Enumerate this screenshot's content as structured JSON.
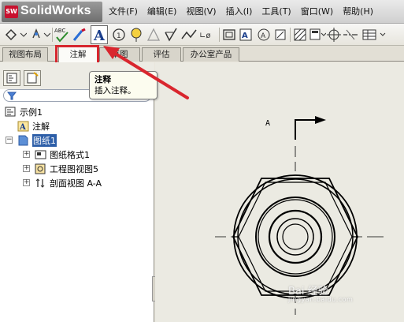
{
  "app": {
    "logo_badge": "SW",
    "name": "SolidWorks"
  },
  "menu": [
    "文件(F)",
    "编辑(E)",
    "视图(V)",
    "插入(I)",
    "工具(T)",
    "窗口(W)",
    "帮助(H)"
  ],
  "toolbar": {
    "spell_label": "ABC",
    "note_label": "A",
    "weld_label": "∟ø"
  },
  "tabs": [
    {
      "label": "视图布局",
      "active": false
    },
    {
      "label": "注解",
      "active": true
    },
    {
      "label": "草图",
      "active": false
    },
    {
      "label": "评估",
      "active": false
    },
    {
      "label": "办公室产品",
      "active": false
    }
  ],
  "tooltip": {
    "title": "注释",
    "description": "插入注释。"
  },
  "tree": {
    "root": "示例1",
    "annotations": "注解",
    "sheet": "图纸1",
    "children": [
      "图纸格式1",
      "工程图视图5",
      "剖面视图 A-A"
    ]
  },
  "drawing": {
    "section_label": "A"
  },
  "watermark": {
    "text": "Bai 经验",
    "sub": "jingyan.baidu.com"
  },
  "colors": {
    "highlight": "#d7262e",
    "selection": "#2d5ea8",
    "brand": "#c8102e"
  }
}
